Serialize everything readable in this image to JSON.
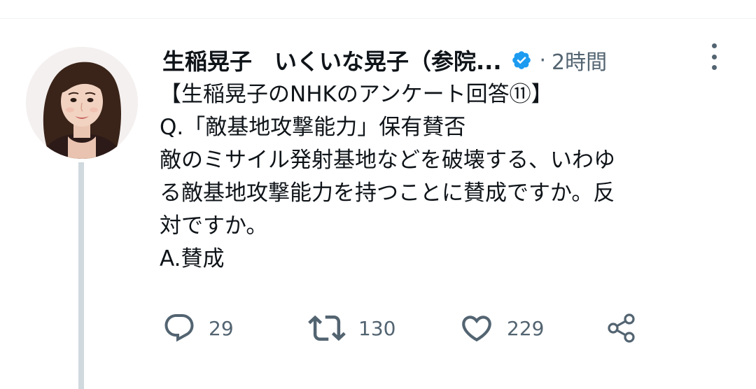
{
  "tweet": {
    "author": {
      "display_name": "生稲晃子　いくいな晃子（参院...",
      "verified": true,
      "avatar_icon": "profile-photo"
    },
    "separator": "·",
    "timestamp": "2時間",
    "text_lines": [
      "【生稲晃子のNHKのアンケート回答⑪】",
      "Q.「敵基地攻撃能力」保有賛否",
      "敵のミサイル発射基地などを破壊する、いわゆ",
      "る敵基地攻撃能力を持つことに賛成ですか。反",
      "対ですか。",
      "A.賛成"
    ],
    "actions": {
      "reply": {
        "icon": "reply-icon",
        "count": "29"
      },
      "retweet": {
        "icon": "retweet-icon",
        "count": "130"
      },
      "like": {
        "icon": "like-icon",
        "count": "229"
      },
      "share": {
        "icon": "share-icon"
      }
    }
  },
  "colors": {
    "text_primary": "#0f1419",
    "text_secondary": "#536471",
    "verified_blue": "#1d9bf0",
    "thread_line": "#cfd9de"
  }
}
